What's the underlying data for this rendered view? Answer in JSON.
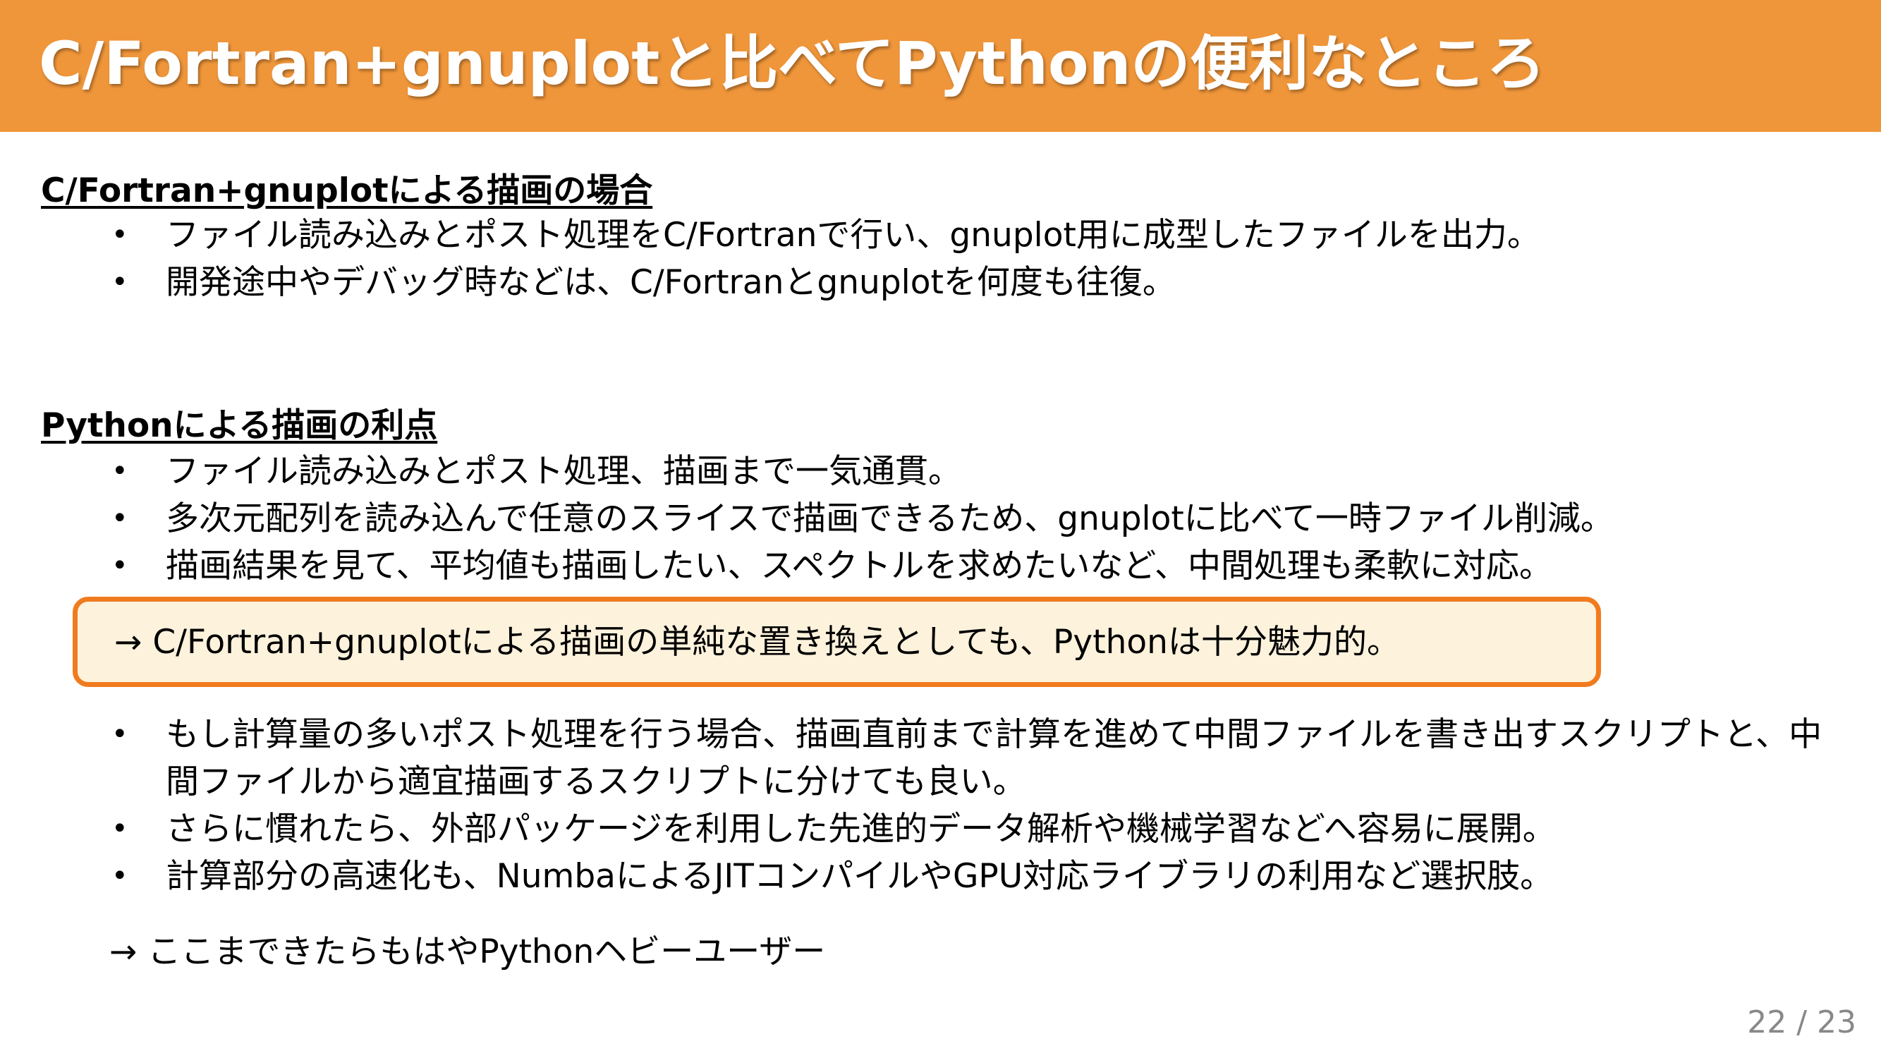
{
  "title": "C/Fortran+gnuplotと比べてPythonの便利なところ",
  "section1": {
    "heading": "C/Fortran+gnuplotによる描画の場合",
    "bullets": [
      "ファイル読み込みとポスト処理をC/Fortranで行い、gnuplot用に成型したファイルを出力。",
      "開発途中やデバッグ時などは、C/Fortranとgnuplotを何度も往復。"
    ]
  },
  "section2": {
    "heading": "Pythonによる描画の利点",
    "bullets": [
      "ファイル読み込みとポスト処理、描画まで一気通貫。",
      "多次元配列を読み込んで任意のスライスで描画できるため、gnuplotに比べて一時ファイル削減。",
      "描画結果を見て、平均値も描画したい、スペクトルを求めたいなど、中間処理も柔軟に対応。"
    ]
  },
  "callout": "→ C/Fortran+gnuplotによる描画の単純な置き換えとしても、Pythonは十分魅力的。",
  "section3": {
    "bullets": [
      "もし計算量の多いポスト処理を行う場合、描画直前まで計算を進めて中間ファイルを書き出すスクリプトと、中間ファイルから適宜描画するスクリプトに分けても良い。",
      "さらに慣れたら、外部パッケージを利用した先進的データ解析や機械学習などへ容易に展開。",
      "計算部分の高速化も、NumbaによるJITコンパイルやGPU対応ライブラリの利用など選択肢。"
    ]
  },
  "conclusion": "→ ここまできたらもはやPythonヘビーユーザー",
  "page_number": "22 / 23",
  "bullet_symbol": "•",
  "colors": {
    "header_background": "#F0963A",
    "callout_border": "#F07B1E",
    "callout_background": "#FDF2DC",
    "page_number": "#888888"
  }
}
